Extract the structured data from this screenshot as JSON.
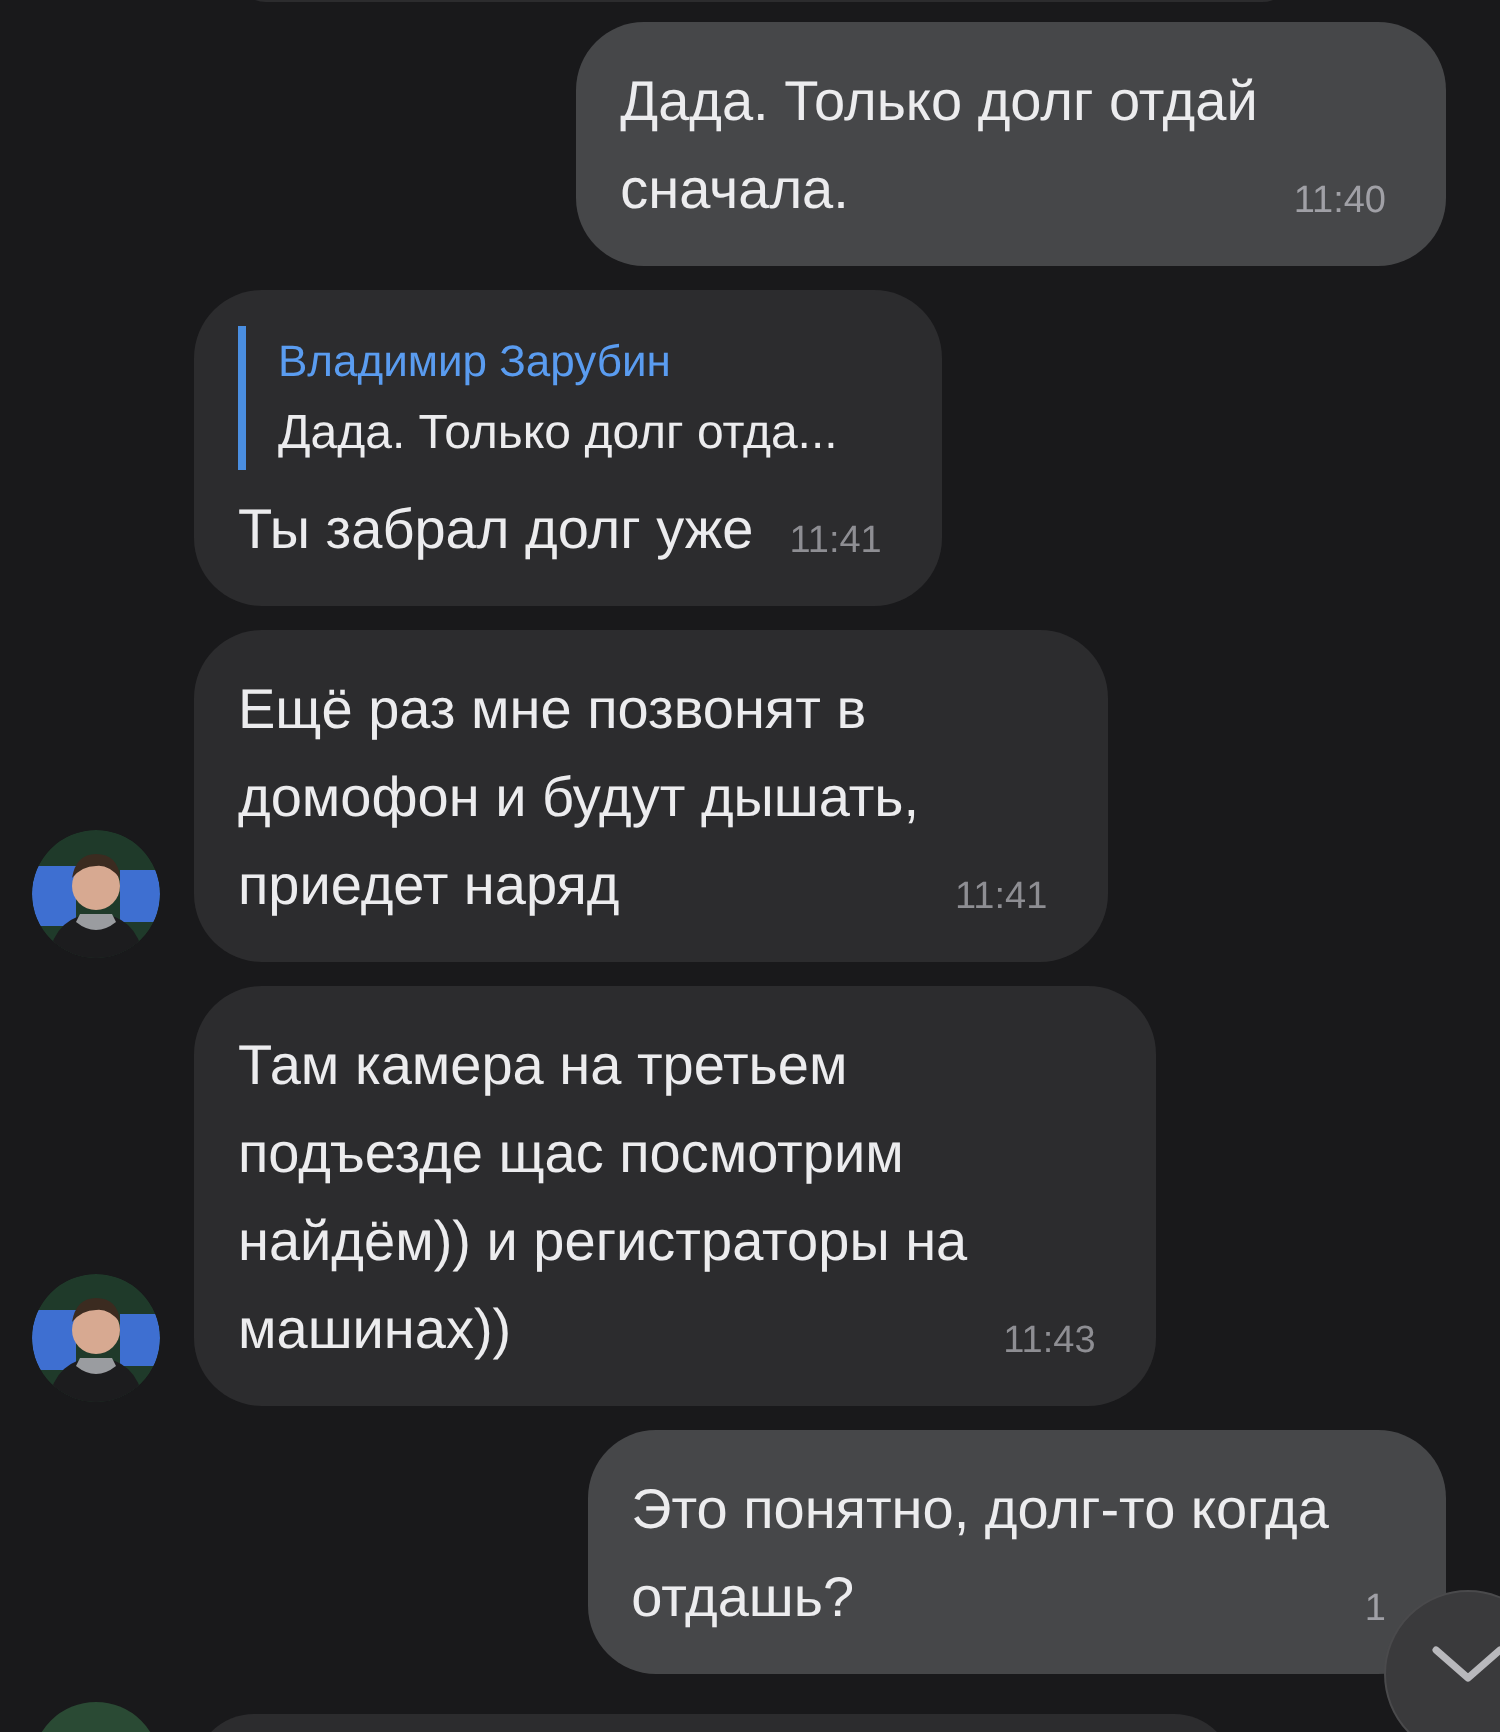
{
  "messages": [
    {
      "kind": "outgoing",
      "lines": [
        "Дада. Только долг отдай",
        "сначала."
      ],
      "time": "11:40"
    },
    {
      "kind": "incoming",
      "reply": {
        "author": "Владимир Зарубин",
        "text": "Дада. Только долг отда..."
      },
      "lines": [
        "Ты забрал долг уже"
      ],
      "time": "11:41",
      "avatar": false
    },
    {
      "kind": "incoming",
      "lines": [
        "Ещё раз мне позвонят в",
        "домофон и будут дышать,",
        "приедет наряд"
      ],
      "time": "11:41",
      "avatar": true
    },
    {
      "kind": "incoming",
      "lines": [
        "Там камера на третьем",
        "подъезде щас посмотрим",
        "найдём)) и регистраторы на",
        "машинах))"
      ],
      "time": "11:43",
      "avatar": true
    },
    {
      "kind": "outgoing",
      "lines": [
        "Это понятно, долг-то когда",
        "отдашь?"
      ],
      "time": "1"
    }
  ]
}
